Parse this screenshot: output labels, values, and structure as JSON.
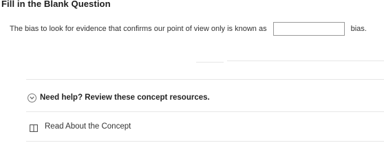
{
  "question": {
    "title": "Fill in the Blank Question",
    "prompt_before": "The bias to look for evidence that confirms our point of view only is known as",
    "answer_value": "",
    "prompt_after": "bias."
  },
  "help": {
    "toggle_label": "Need help? Review these concept resources.",
    "toggle_icon": "chevron-down-circle-icon",
    "resources": [
      {
        "label": "Read About the Concept",
        "icon": "book-icon"
      }
    ]
  }
}
